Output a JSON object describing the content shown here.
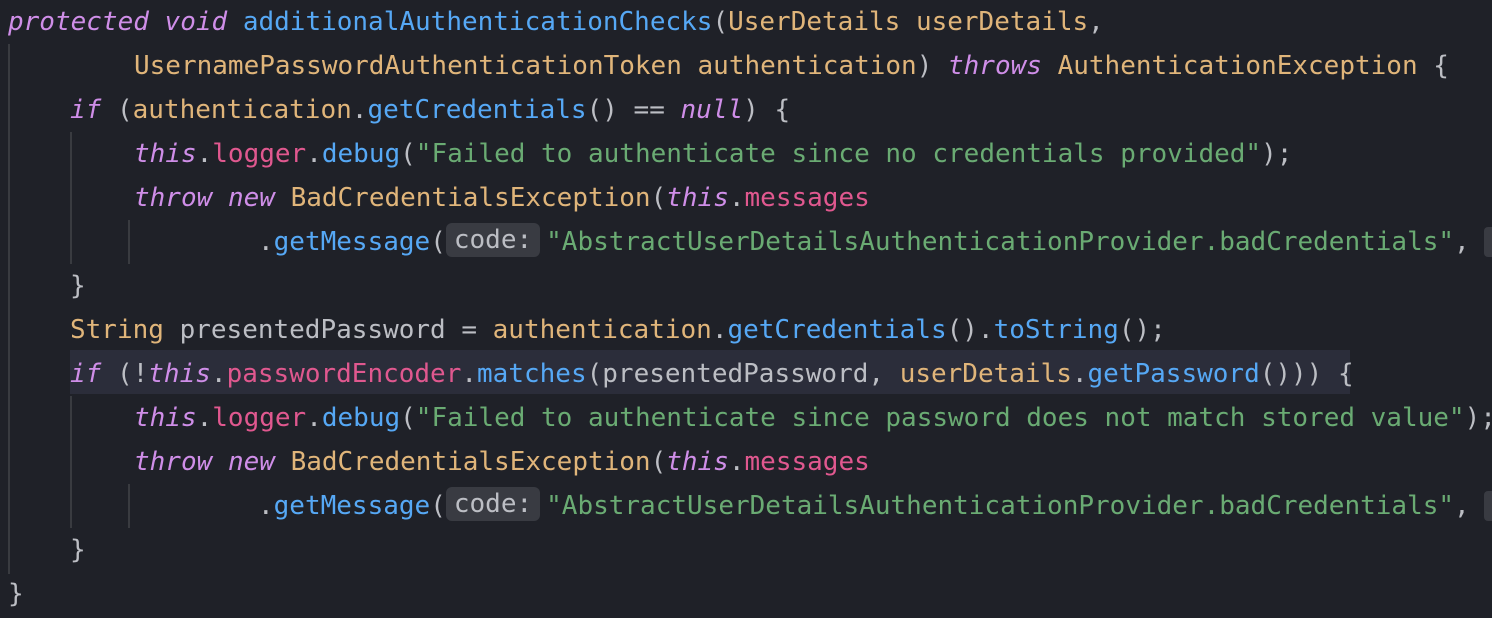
{
  "editor": {
    "lines": [
      {
        "kw1": "protected",
        "kw2": "void",
        "method": "additionalAuthenticationChecks",
        "p1": "(",
        "type1": "UserDetails",
        "param1": "userDetails",
        "p2": ","
      },
      {
        "type1": "UsernamePasswordAuthenticationToken",
        "param1": "authentication",
        "p1": ")",
        "kw1": "throws",
        "type2": "AuthenticationException",
        "p2": "{"
      },
      {
        "kw1": "if",
        "p1": "(",
        "param1": "authentication",
        "p2": ".",
        "method": "getCredentials",
        "p3": "() ==",
        "kw2": "null",
        "p4": ") {"
      },
      {
        "kw1": "this",
        "p1": ".",
        "field": "logger",
        "p2": ".",
        "method": "debug",
        "p3": "(",
        "str": "\"Failed to authenticate since no credentials provided\"",
        "p4": ");"
      },
      {
        "kw1": "throw",
        "kw2": "new",
        "type1": "BadCredentialsException",
        "p1": "(",
        "kw3": "this",
        "p2": ".",
        "field": "messages"
      },
      {
        "p1": ".",
        "method": "getMessage",
        "p2": "(",
        "hint": "code:",
        "str": "\"AbstractUserDetailsAuthenticationProvider.badCredentials\"",
        "p3": ","
      },
      {
        "p1": "}"
      },
      {
        "type1": "String",
        "plain1": "presentedPassword =",
        "param1": "authentication",
        "p1": ".",
        "method1": "getCredentials",
        "p2": "().",
        "method2": "toString",
        "p3": "();"
      },
      {
        "kw1": "if",
        "p1": "(!",
        "kw2": "this",
        "p2": ".",
        "field": "passwordEncoder",
        "p3": ".",
        "method1": "matches",
        "p4": "(presentedPassword,",
        "param1": "userDetails",
        "p5": ".",
        "method2": "getPassword",
        "p6": "())) {"
      },
      {
        "kw1": "this",
        "p1": ".",
        "field": "logger",
        "p2": ".",
        "method": "debug",
        "p3": "(",
        "str": "\"Failed to authenticate since password does not match stored value\"",
        "p4": ");"
      },
      {
        "kw1": "throw",
        "kw2": "new",
        "type1": "BadCredentialsException",
        "p1": "(",
        "kw3": "this",
        "p2": ".",
        "field": "messages"
      },
      {
        "p1": ".",
        "method": "getMessage",
        "p2": "(",
        "hint": "code:",
        "str": "\"AbstractUserDetailsAuthenticationProvider.badCredentials\"",
        "p3": ","
      },
      {
        "p1": "}"
      },
      {
        "p1": "}"
      }
    ]
  },
  "colors": {
    "background": "#1f2128",
    "keyword": "#cf8ee8",
    "method": "#56a8f5",
    "type": "#e0b57a",
    "field": "#e0588f",
    "string": "#6aab73",
    "text": "#bcbec4"
  }
}
